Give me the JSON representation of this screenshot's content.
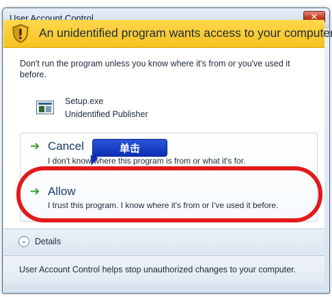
{
  "window": {
    "title": "User Account Control",
    "close_glyph": "✕"
  },
  "header": {
    "icon": "uac-shield-icon",
    "text": "An unidentified program wants access to your computer",
    "color": "#f8c11f"
  },
  "body": {
    "warning": "Don't run the program unless you know where it's from or you've used it before.",
    "program": {
      "icon": "program-icon",
      "name": "Setup.exe",
      "publisher": "Unidentified Publisher"
    }
  },
  "options": {
    "cancel": {
      "icon": "green-arrow-icon",
      "title": "Cancel",
      "description": "I don't know where this program is from or what it's for."
    },
    "allow": {
      "icon": "green-arrow-icon",
      "title": "Allow",
      "description": "I trust this program. I know where it's from or I've used it before."
    }
  },
  "annotation": {
    "callout_label": "单击",
    "callout_color": "#0c2fb4",
    "highlight_color": "#e31a1a"
  },
  "details": {
    "icon": "chevron-down-icon",
    "label": "Details"
  },
  "footer": {
    "text": "User Account Control helps stop unauthorized changes to your computer."
  }
}
